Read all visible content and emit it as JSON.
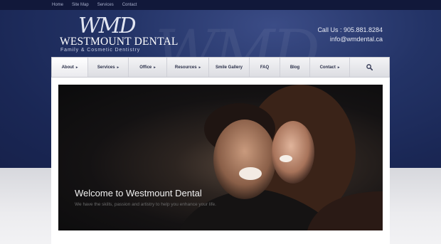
{
  "top_links": [
    "Home",
    "Site Map",
    "Services",
    "Contact"
  ],
  "logo": {
    "monogram": "WMD",
    "name": "WESTMOUNT DENTAL",
    "tagline": "Family & Cosmetic Dentistry"
  },
  "watermark": "WMD",
  "contact": {
    "phone": "Call Us : 905.881.8284",
    "email": "info@wmdental.ca"
  },
  "nav": [
    {
      "label": "About",
      "arrow": "▸",
      "active": true
    },
    {
      "label": "Services",
      "arrow": "▸"
    },
    {
      "label": "Office",
      "arrow": "▸"
    },
    {
      "label": "Resources",
      "arrow": "▸"
    },
    {
      "label": "Smile Gallery",
      "arrow": ""
    },
    {
      "label": "FAQ",
      "arrow": ""
    },
    {
      "label": "Blog",
      "arrow": ""
    },
    {
      "label": "Contact",
      "arrow": "▸"
    }
  ],
  "hero": {
    "title": "Welcome to Westmount Dental",
    "subtitle": "We have the skills, passion and artistry to help you enhance your life."
  },
  "colors": {
    "header_navy": "#1a2755",
    "topbar": "#11183a"
  }
}
